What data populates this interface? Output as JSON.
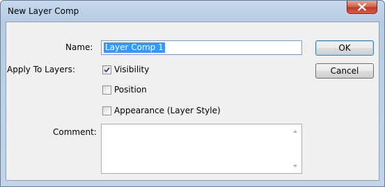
{
  "window": {
    "title": "New Layer Comp"
  },
  "form": {
    "name_label": "Name:",
    "name_value": "Layer Comp 1",
    "apply_label": "Apply To Layers:",
    "checkboxes": [
      {
        "label": "Visibility",
        "checked": true
      },
      {
        "label": "Position",
        "checked": false
      },
      {
        "label": "Appearance (Layer Style)",
        "checked": false
      }
    ],
    "comment_label": "Comment:",
    "comment_value": ""
  },
  "buttons": {
    "ok": "OK",
    "cancel": "Cancel"
  },
  "colors": {
    "selection": "#3399ff",
    "close_button": "#c1392a"
  }
}
